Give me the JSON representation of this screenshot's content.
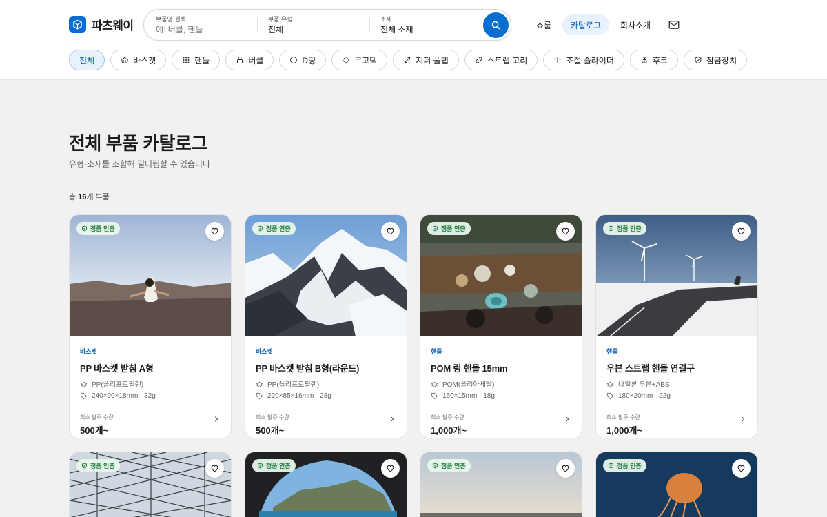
{
  "brand": {
    "name": "파츠웨이",
    "accent": "#0a6ed1"
  },
  "search": {
    "name_label": "부품명 검색",
    "name_placeholder": "예: 버클, 핸들",
    "type_label": "부품 유형",
    "type_value": "전체",
    "material_label": "소재",
    "material_value": "전체 소재"
  },
  "nav": {
    "showroom": "쇼룸",
    "catalog": "카탈로그",
    "about": "회사소개"
  },
  "filters": [
    {
      "label": "전체",
      "icon": "none"
    },
    {
      "label": "바스켓",
      "icon": "basket-icon"
    },
    {
      "label": "핸들",
      "icon": "grid-icon"
    },
    {
      "label": "버클",
      "icon": "lock-icon"
    },
    {
      "label": "D링",
      "icon": "ring-icon"
    },
    {
      "label": "로고택",
      "icon": "tag-icon"
    },
    {
      "label": "지퍼 풀탭",
      "icon": "arrows-icon"
    },
    {
      "label": "스트랩 고리",
      "icon": "link-icon"
    },
    {
      "label": "조절 슬라이더",
      "icon": "sliders-icon"
    },
    {
      "label": "후크",
      "icon": "anchor-icon"
    },
    {
      "label": "잠금장치",
      "icon": "shield-icon"
    }
  ],
  "page": {
    "title": "전체 부품 카탈로그",
    "subtitle": "유형·소재를 조합해 필터링할 수 있습니다",
    "count_prefix": "총 ",
    "count": "16",
    "count_suffix": "개 부품"
  },
  "card_common": {
    "badge": "정품 인증",
    "moq_label": "최소 발주 수량"
  },
  "products": [
    {
      "category": "바스켓",
      "name": "PP 바스켓 받침 A형",
      "material": "PP(폴리프로필렌)",
      "size": "240×90×18mm · 32g",
      "moq": "500개~"
    },
    {
      "category": "바스켓",
      "name": "PP 바스켓 받침 B형(라운드)",
      "material": "PP(폴리프로필렌)",
      "size": "220×85×16mm · 28g",
      "moq": "500개~"
    },
    {
      "category": "핸들",
      "name": "POM 링 핸들 15mm",
      "material": "POM(폴리아세탈)",
      "size": "150×15mm · 18g",
      "moq": "1,000개~"
    },
    {
      "category": "핸들",
      "name": "우븐 스트랩 핸들 연결구",
      "material": "나일론 우븐+ABS",
      "size": "180×20mm · 22g",
      "moq": "1,000개~"
    }
  ]
}
